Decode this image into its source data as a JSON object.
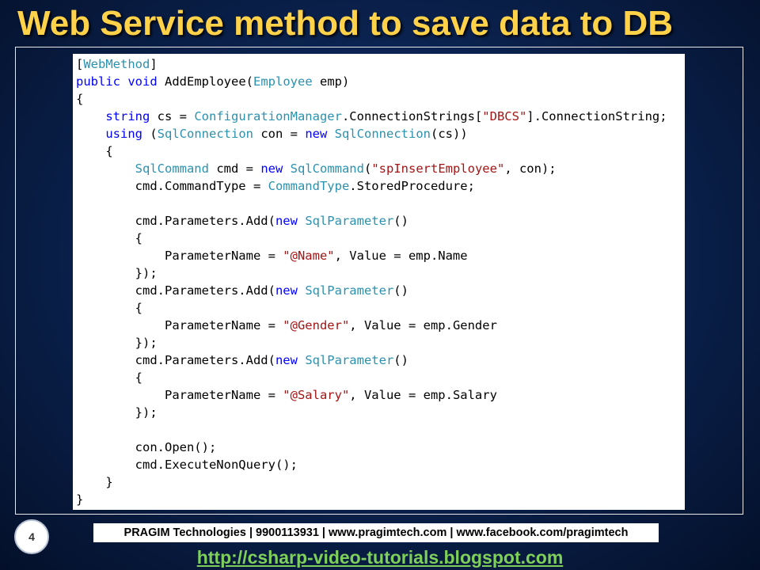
{
  "slide": {
    "title": "Web Service method to save data to DB",
    "page_number": "4",
    "footer_bar": "PRAGIM Technologies | 9900113931 | www.pragimtech.com | www.facebook.com/pragimtech",
    "footer_link": "http://csharp-video-tutorials.blogspot.com"
  },
  "colors": {
    "title": "#ffd24a",
    "keyword": "#0000ff",
    "type": "#2b91af",
    "string": "#a31515",
    "link": "#7fd05a"
  },
  "code": {
    "language": "C#",
    "lines": [
      [
        {
          "c": "tx",
          "t": "["
        },
        {
          "c": "ty",
          "t": "WebMethod"
        },
        {
          "c": "tx",
          "t": "]"
        }
      ],
      [
        {
          "c": "kw",
          "t": "public"
        },
        {
          "c": "tx",
          "t": " "
        },
        {
          "c": "kw",
          "t": "void"
        },
        {
          "c": "tx",
          "t": " AddEmployee("
        },
        {
          "c": "ty",
          "t": "Employee"
        },
        {
          "c": "tx",
          "t": " emp)"
        }
      ],
      [
        {
          "c": "tx",
          "t": "{"
        }
      ],
      [
        {
          "c": "tx",
          "t": "    "
        },
        {
          "c": "kw",
          "t": "string"
        },
        {
          "c": "tx",
          "t": " cs = "
        },
        {
          "c": "ty",
          "t": "ConfigurationManager"
        },
        {
          "c": "tx",
          "t": ".ConnectionStrings["
        },
        {
          "c": "st",
          "t": "\"DBCS\""
        },
        {
          "c": "tx",
          "t": "].ConnectionString;"
        }
      ],
      [
        {
          "c": "tx",
          "t": "    "
        },
        {
          "c": "kw",
          "t": "using"
        },
        {
          "c": "tx",
          "t": " ("
        },
        {
          "c": "ty",
          "t": "SqlConnection"
        },
        {
          "c": "tx",
          "t": " con = "
        },
        {
          "c": "kw",
          "t": "new"
        },
        {
          "c": "tx",
          "t": " "
        },
        {
          "c": "ty",
          "t": "SqlConnection"
        },
        {
          "c": "tx",
          "t": "(cs))"
        }
      ],
      [
        {
          "c": "tx",
          "t": "    {"
        }
      ],
      [
        {
          "c": "tx",
          "t": "        "
        },
        {
          "c": "ty",
          "t": "SqlCommand"
        },
        {
          "c": "tx",
          "t": " cmd = "
        },
        {
          "c": "kw",
          "t": "new"
        },
        {
          "c": "tx",
          "t": " "
        },
        {
          "c": "ty",
          "t": "SqlCommand"
        },
        {
          "c": "tx",
          "t": "("
        },
        {
          "c": "st",
          "t": "\"spInsertEmployee\""
        },
        {
          "c": "tx",
          "t": ", con);"
        }
      ],
      [
        {
          "c": "tx",
          "t": "        cmd.CommandType = "
        },
        {
          "c": "ty",
          "t": "CommandType"
        },
        {
          "c": "tx",
          "t": ".StoredProcedure;"
        }
      ],
      [],
      [
        {
          "c": "tx",
          "t": "        cmd.Parameters.Add("
        },
        {
          "c": "kw",
          "t": "new"
        },
        {
          "c": "tx",
          "t": " "
        },
        {
          "c": "ty",
          "t": "SqlParameter"
        },
        {
          "c": "tx",
          "t": "()"
        }
      ],
      [
        {
          "c": "tx",
          "t": "        {"
        }
      ],
      [
        {
          "c": "tx",
          "t": "            ParameterName = "
        },
        {
          "c": "st",
          "t": "\"@Name\""
        },
        {
          "c": "tx",
          "t": ", Value = emp.Name"
        }
      ],
      [
        {
          "c": "tx",
          "t": "        });"
        }
      ],
      [
        {
          "c": "tx",
          "t": "        cmd.Parameters.Add("
        },
        {
          "c": "kw",
          "t": "new"
        },
        {
          "c": "tx",
          "t": " "
        },
        {
          "c": "ty",
          "t": "SqlParameter"
        },
        {
          "c": "tx",
          "t": "()"
        }
      ],
      [
        {
          "c": "tx",
          "t": "        {"
        }
      ],
      [
        {
          "c": "tx",
          "t": "            ParameterName = "
        },
        {
          "c": "st",
          "t": "\"@Gender\""
        },
        {
          "c": "tx",
          "t": ", Value = emp.Gender"
        }
      ],
      [
        {
          "c": "tx",
          "t": "        });"
        }
      ],
      [
        {
          "c": "tx",
          "t": "        cmd.Parameters.Add("
        },
        {
          "c": "kw",
          "t": "new"
        },
        {
          "c": "tx",
          "t": " "
        },
        {
          "c": "ty",
          "t": "SqlParameter"
        },
        {
          "c": "tx",
          "t": "()"
        }
      ],
      [
        {
          "c": "tx",
          "t": "        {"
        }
      ],
      [
        {
          "c": "tx",
          "t": "            ParameterName = "
        },
        {
          "c": "st",
          "t": "\"@Salary\""
        },
        {
          "c": "tx",
          "t": ", Value = emp.Salary"
        }
      ],
      [
        {
          "c": "tx",
          "t": "        });"
        }
      ],
      [],
      [
        {
          "c": "tx",
          "t": "        con.Open();"
        }
      ],
      [
        {
          "c": "tx",
          "t": "        cmd.ExecuteNonQuery();"
        }
      ],
      [
        {
          "c": "tx",
          "t": "    }"
        }
      ],
      [
        {
          "c": "tx",
          "t": "}"
        }
      ]
    ]
  }
}
